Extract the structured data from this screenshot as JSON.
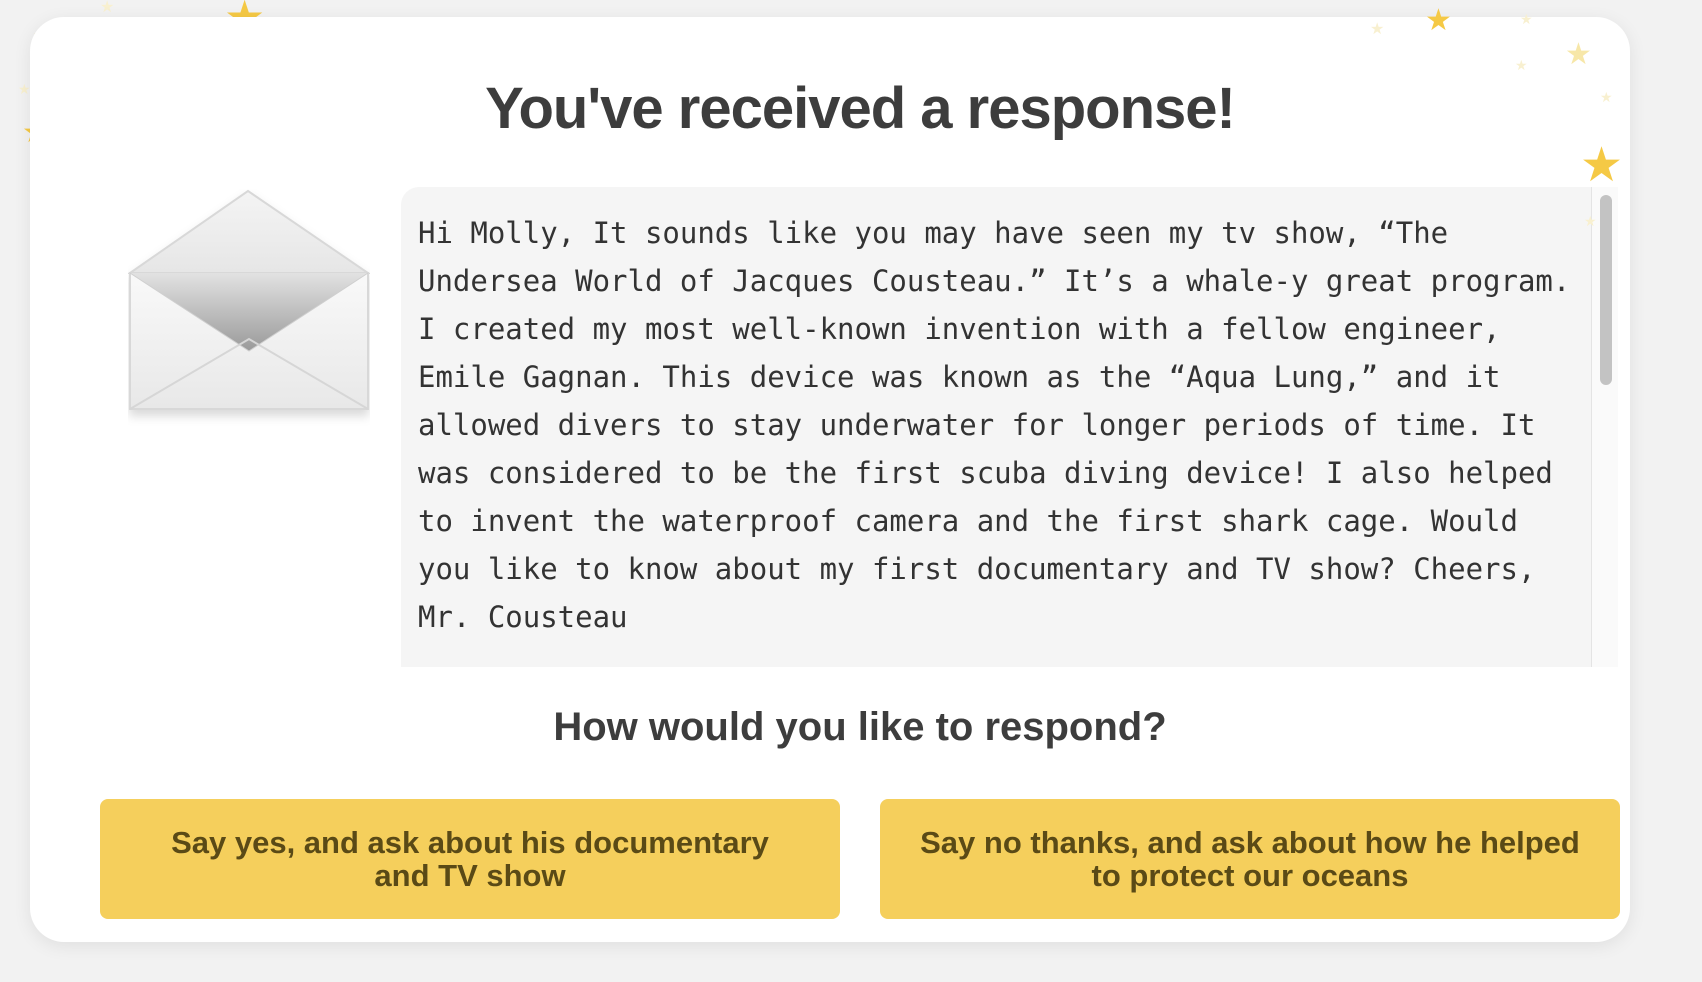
{
  "dialog": {
    "title": "You've received a response!",
    "message": "Hi Molly, It sounds like you may have seen my tv show, “The Undersea World of Jacques Cousteau.” It’s a whale-y great program. I created my most well-known invention with a fellow engineer, Emile Gagnan. This device was known as the “Aqua Lung,” and it allowed divers to stay underwater for longer periods of time. It was considered to be the first scuba diving device! I also helped to invent the waterproof camera and the first shark cage. Would you like to know about my first documentary and TV show? Cheers, Mr. Cousteau",
    "icon": "envelope-open-icon",
    "decoration": "star-icon"
  },
  "respond": {
    "prompt": "How would you like to respond?",
    "options": [
      {
        "label": "Say yes, and ask about his documentary and TV show"
      },
      {
        "label": "Say no thanks, and ask about how he helped to protect our oceans"
      }
    ]
  },
  "colors": {
    "button": "#f5cf5c",
    "button_text": "#5a4a16",
    "star": "#f5c945",
    "heading": "#3d3d3d"
  }
}
